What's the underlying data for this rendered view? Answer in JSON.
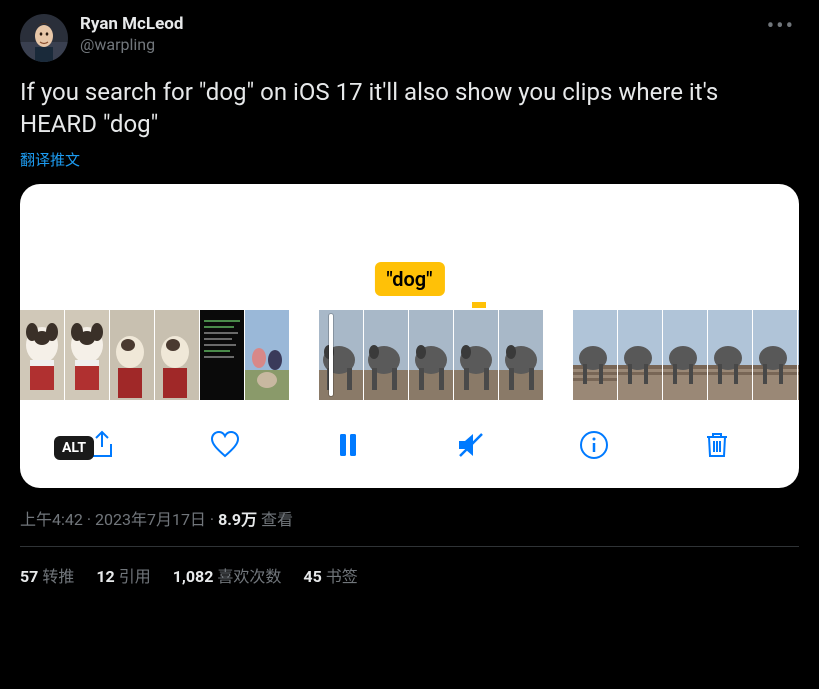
{
  "user": {
    "display_name": "Ryan McLeod",
    "handle": "@warpling"
  },
  "tweet_text": "If you search for \"dog\" on iOS 17 it'll also show you clips where it's HEARD \"dog\"",
  "translate_label": "翻译推文",
  "media": {
    "bubble_text": "\"dog\"",
    "alt_label": "ALT",
    "controls": {
      "share": "share",
      "like": "like",
      "pause": "pause",
      "mute": "mute",
      "info": "info",
      "delete": "delete"
    }
  },
  "meta": {
    "time": "上午4:42",
    "date": "2023年7月17日",
    "views_count": "8.9万",
    "views_label": "查看"
  },
  "stats": {
    "retweets_count": "57",
    "retweets_label": "转推",
    "quotes_count": "12",
    "quotes_label": "引用",
    "likes_count": "1,082",
    "likes_label": "喜欢次数",
    "bookmarks_count": "45",
    "bookmarks_label": "书签"
  }
}
